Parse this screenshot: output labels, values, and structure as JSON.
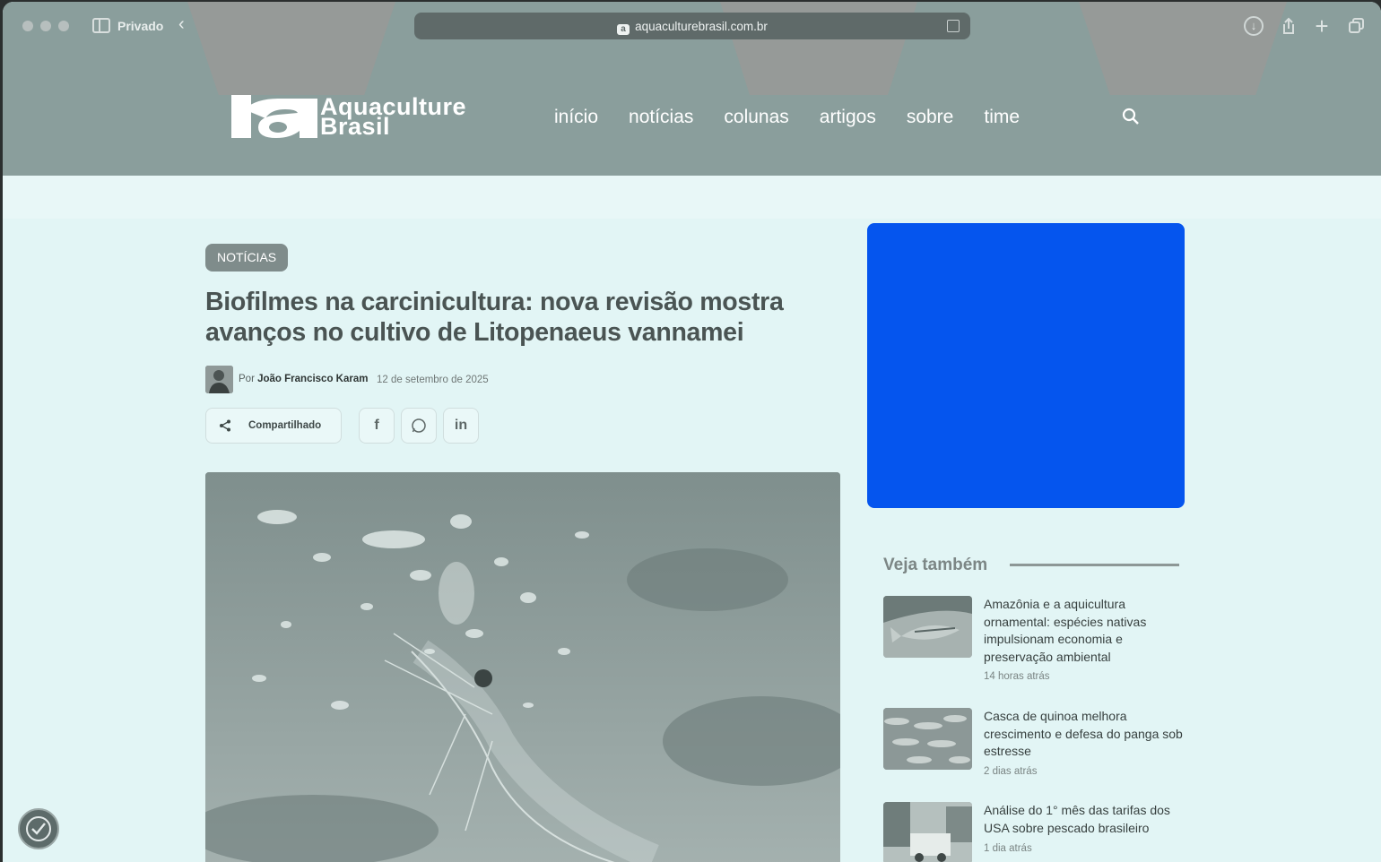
{
  "browser": {
    "private_label": "Privado",
    "url": "aquaculturebrasil.com.br"
  },
  "site": {
    "logo_line1": "Aquaculture",
    "logo_line2": "Brasil",
    "nav": [
      "início",
      "notícias",
      "colunas",
      "artigos",
      "sobre",
      "time"
    ]
  },
  "article": {
    "category": "NOTÍCIAS",
    "title": "Biofilmes na carcinicultura: nova revisão mostra avanços no cultivo de Litopenaeus vannamei",
    "by_prefix": "Por",
    "author": "João Francisco Karam",
    "date": "12 de setembro de 2025",
    "share_label": "Compartilhado"
  },
  "sidebar": {
    "heading": "Veja também",
    "related": [
      {
        "title": "Amazônia e a aquicultura ornamental: espécies nativas impulsionam economia e preservação ambiental",
        "ago": "14 horas atrás"
      },
      {
        "title": "Casca de quinoa melhora crescimento e defesa do panga sob estresse",
        "ago": "2 dias atrás"
      },
      {
        "title": "Análise do 1° mês das tarifas dos USA sobre pescado brasileiro",
        "ago": "1 dia atrás"
      }
    ]
  },
  "colors": {
    "ad_block": "#0555ee",
    "header": "#8a9e9c",
    "page_bg": "#e2f5f5"
  }
}
